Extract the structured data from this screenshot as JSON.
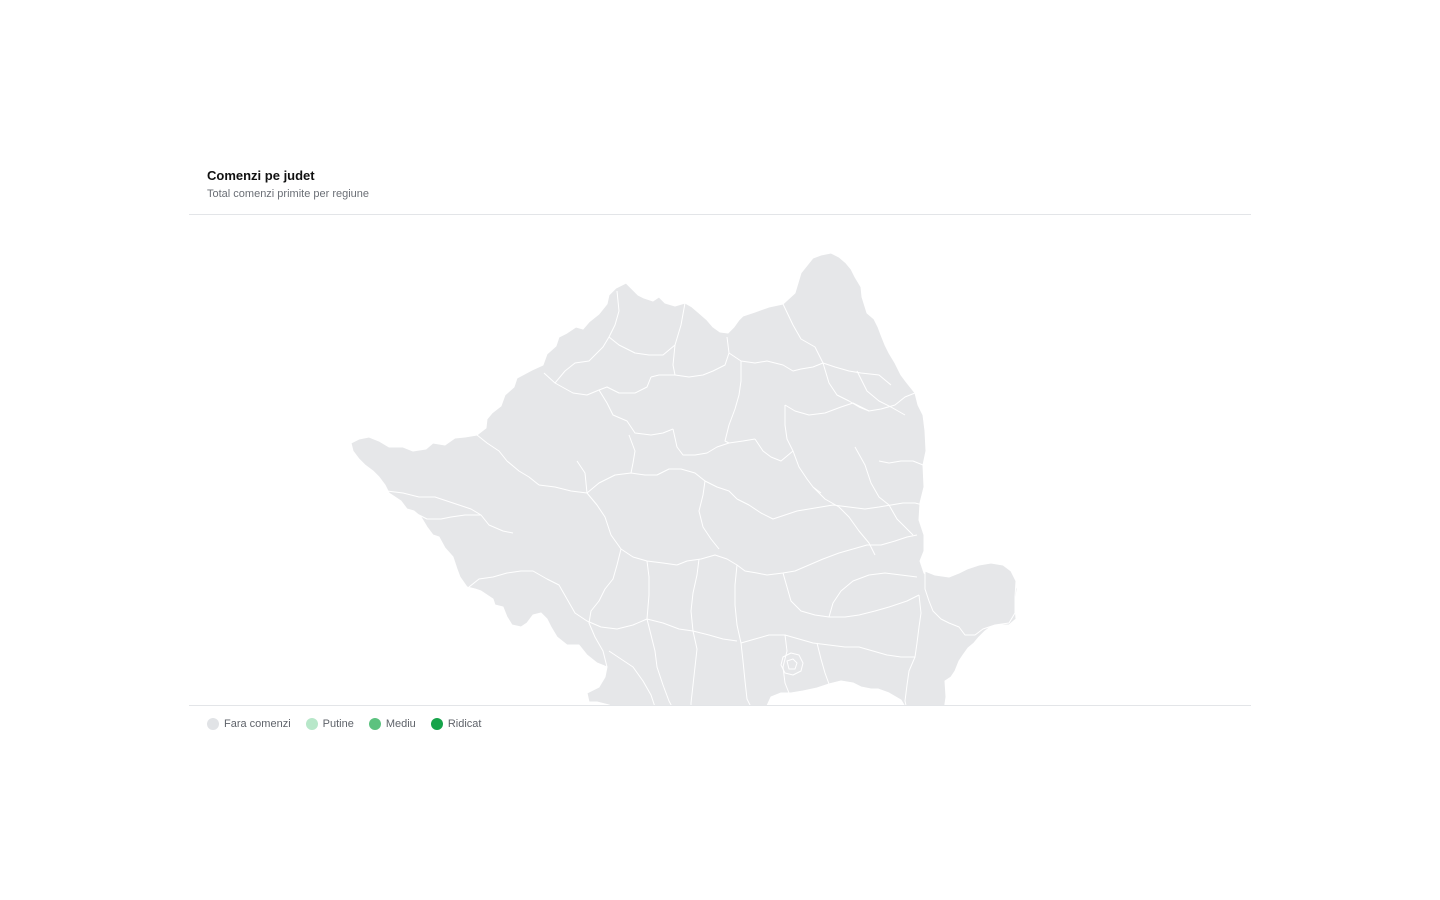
{
  "card": {
    "title": "Comenzi pe judet",
    "subtitle": "Total comenzi primite per regiune"
  },
  "map": {
    "region": "Romania",
    "base_fill": "#e6e7e9",
    "border_color": "#ffffff"
  },
  "legend": {
    "items": [
      {
        "label": "Fara comenzi",
        "color": "#e1e3e6"
      },
      {
        "label": "Putine",
        "color": "#b7e7c9"
      },
      {
        "label": "Mediu",
        "color": "#5cc27f"
      },
      {
        "label": "Ridicat",
        "color": "#16a34a"
      }
    ]
  }
}
